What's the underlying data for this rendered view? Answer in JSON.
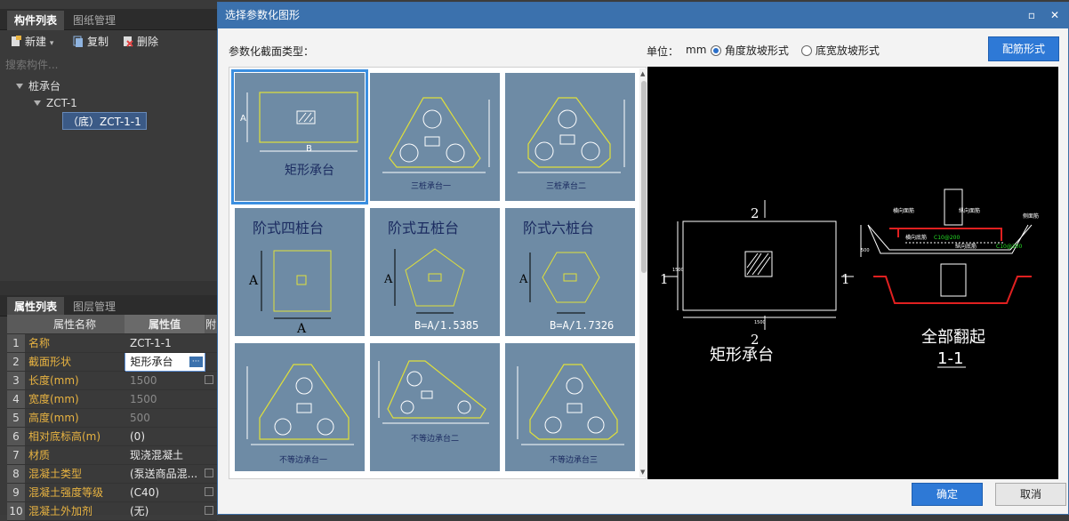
{
  "left": {
    "tabs_top": [
      "构件列表",
      "图纸管理"
    ],
    "toolbar": {
      "new": "新建",
      "copy": "复制",
      "delete": "删除"
    },
    "search_placeholder": "搜索构件...",
    "tree": {
      "root": "桩承台",
      "child": "ZCT-1",
      "leaf": "（底）ZCT-1-1"
    },
    "tabs_bottom": [
      "属性列表",
      "图层管理"
    ],
    "prop_headers": {
      "name": "属性名称",
      "value": "属性值",
      "extra": "附"
    },
    "props": [
      {
        "num": "1",
        "name": "名称",
        "value": "ZCT-1-1"
      },
      {
        "num": "2",
        "name": "截面形状",
        "value": "矩形承台"
      },
      {
        "num": "3",
        "name": "长度(mm)",
        "value": "1500"
      },
      {
        "num": "4",
        "name": "宽度(mm)",
        "value": "1500"
      },
      {
        "num": "5",
        "name": "高度(mm)",
        "value": "500"
      },
      {
        "num": "6",
        "name": "相对底标高(m)",
        "value": "(0)"
      },
      {
        "num": "7",
        "name": "材质",
        "value": "现浇混凝土"
      },
      {
        "num": "8",
        "name": "混凝土类型",
        "value": "(泵送商品混..."
      },
      {
        "num": "9",
        "name": "混凝土强度等级",
        "value": "(C40)"
      },
      {
        "num": "10",
        "name": "混凝土外加剂",
        "value": "(无)"
      }
    ]
  },
  "dialog": {
    "title": "选择参数化图形",
    "section_label": "参数化截面类型：",
    "unit_label": "单位：",
    "unit_value": "mm",
    "radio1": "角度放坡形式",
    "radio2": "底宽放坡形式",
    "rebar_button": "配筋形式",
    "ok": "确定",
    "cancel": "取消",
    "gallery": [
      {
        "label": "矩形承台",
        "dim1": "A",
        "dim2": "B"
      },
      {
        "label": "三桩承台一"
      },
      {
        "label": "三桩承台二"
      },
      {
        "label": "阶式四桩台",
        "dim1": "A",
        "dim2": "A"
      },
      {
        "label": "阶式五桩台",
        "dim1": "A",
        "formula": "B=A/1.5385"
      },
      {
        "label": "阶式六桩台",
        "dim1": "A",
        "formula": "B=A/1.7326"
      },
      {
        "label": "不等边承台一"
      },
      {
        "label": "不等边承台二"
      },
      {
        "label": "不等边承台三"
      }
    ],
    "preview": {
      "section_mark": "2",
      "side_mark": "1",
      "dim_h": "1500",
      "dim_v": "1500",
      "caption": "矩形承台",
      "right_caption": "全部翻起",
      "section_name": "1-1",
      "rebar_labels": [
        "横向面筋",
        "纵向面筋",
        "横向底筋",
        "纵向底筋",
        "侧面筋"
      ],
      "rebar_values": [
        "C10@200",
        "C10@200"
      ],
      "dim_500": "500"
    }
  }
}
